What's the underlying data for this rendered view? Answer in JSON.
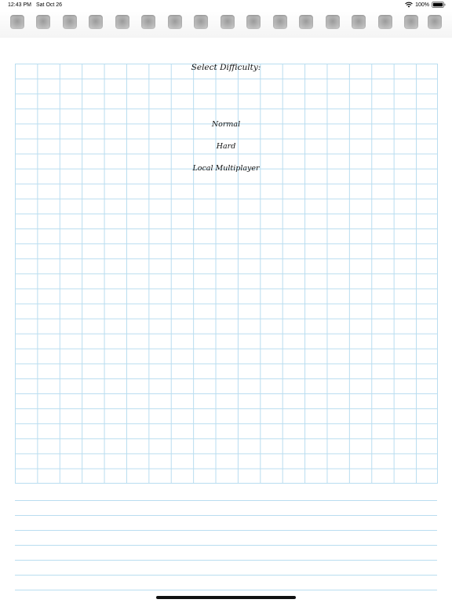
{
  "status_bar": {
    "time": "12:43 PM",
    "date": "Sat Oct 26",
    "battery": "100%"
  },
  "menu": {
    "title": "Select Difficulty:",
    "options": [
      "Normal",
      "Hard",
      "Local Multiplayer"
    ]
  }
}
